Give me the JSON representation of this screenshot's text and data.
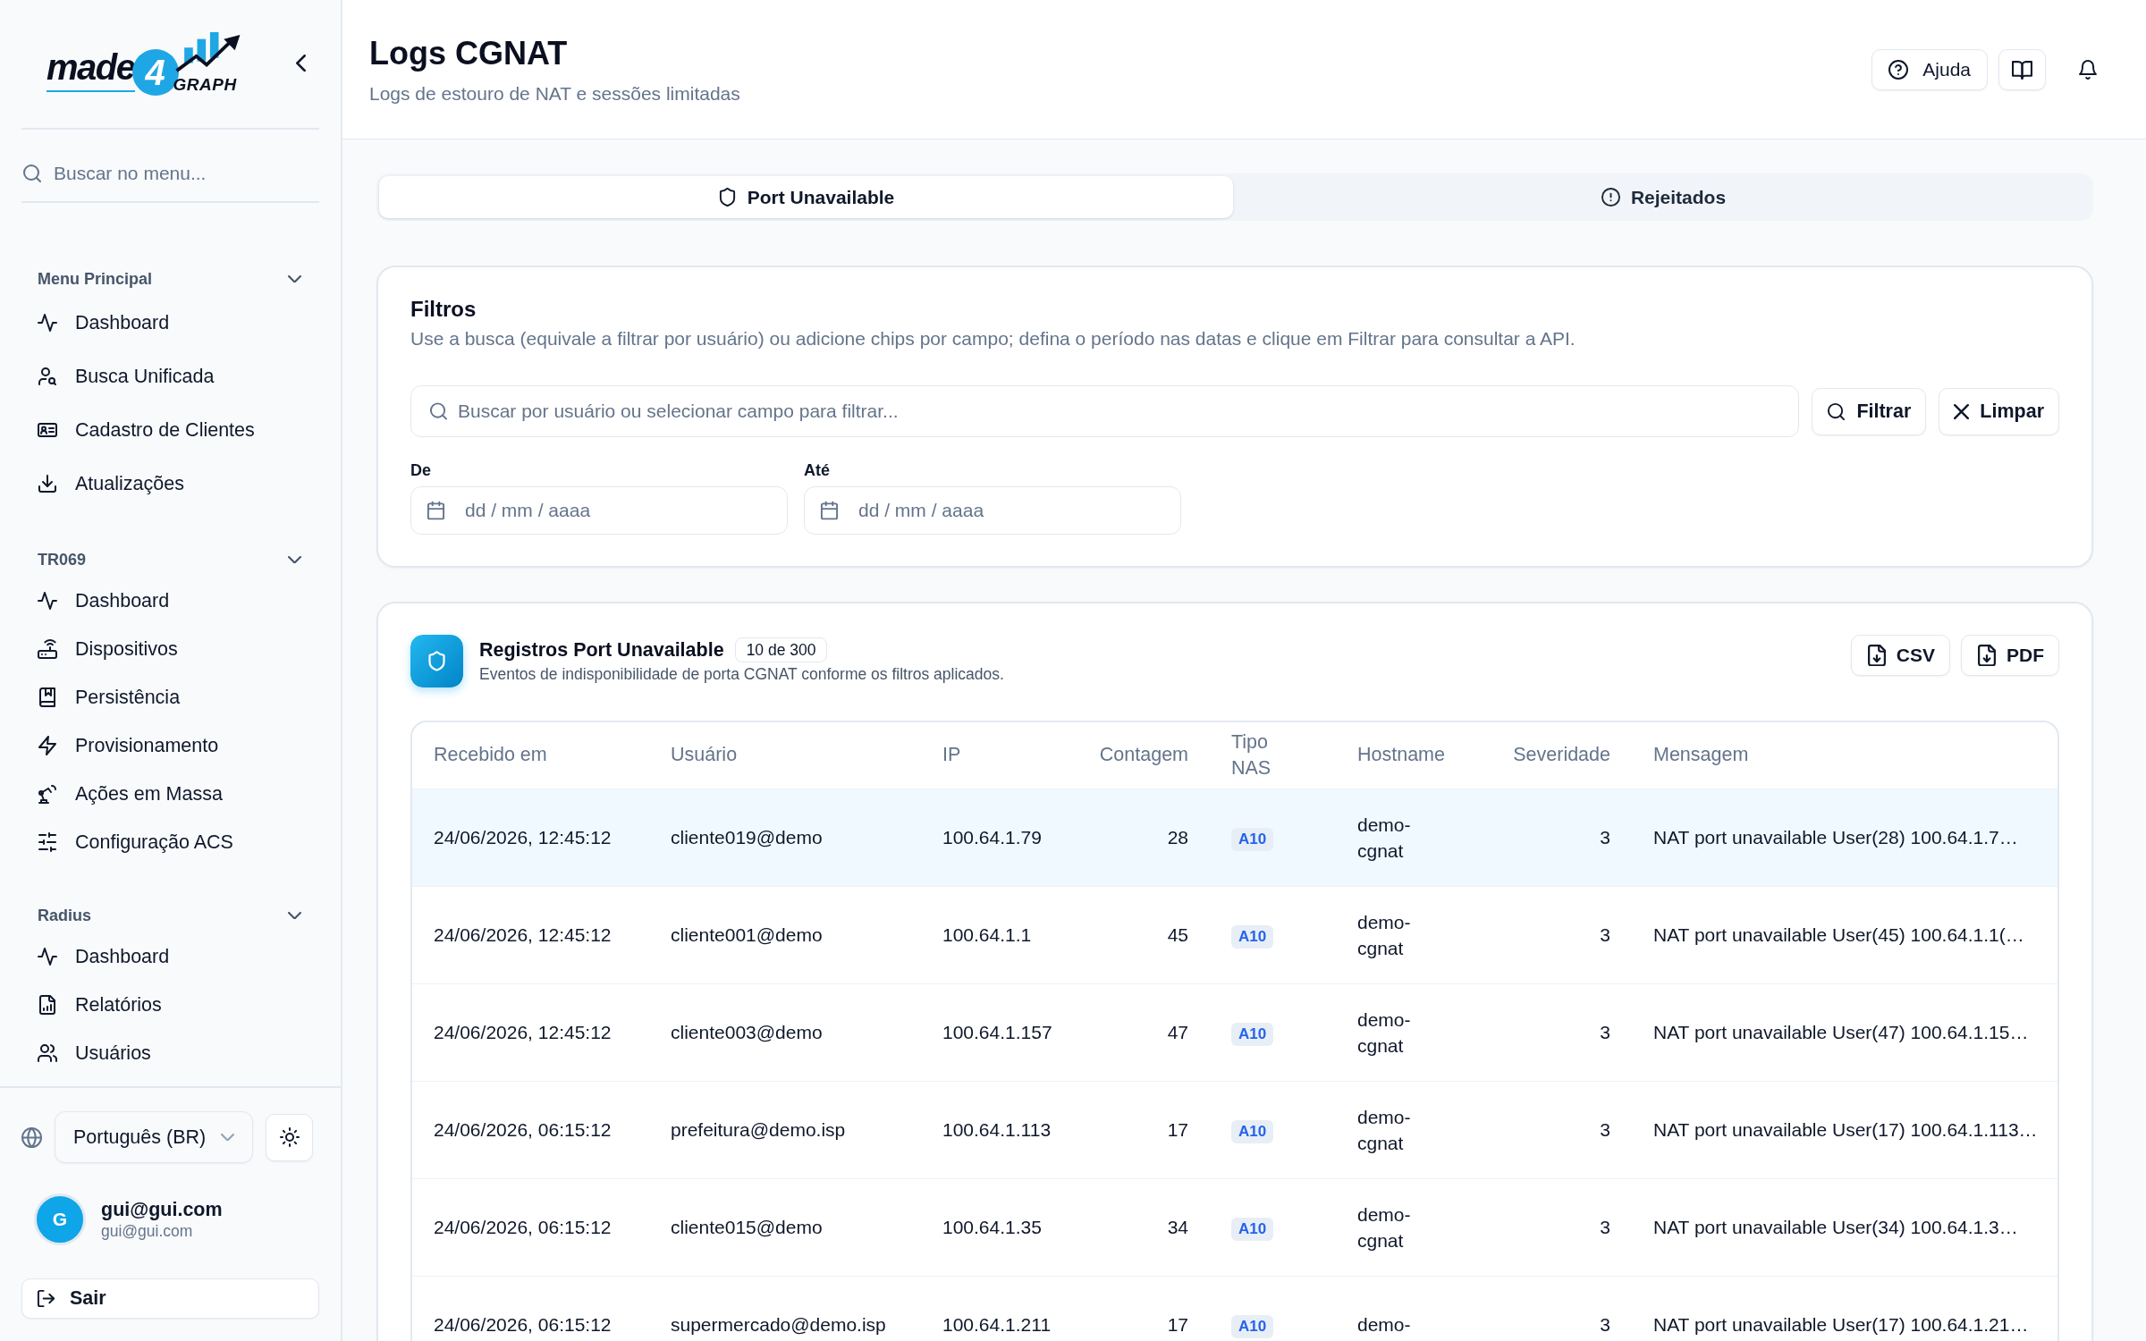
{
  "sidebar": {
    "logo": {
      "word": "made",
      "digit": "4",
      "tagline": "GRAPH"
    },
    "search": {
      "placeholder": "Buscar no menu..."
    },
    "groups": [
      {
        "title": "Menu Principal",
        "expanded": true,
        "items": [
          {
            "label": "Dashboard"
          },
          {
            "label": "Busca Unificada"
          },
          {
            "label": "Cadastro de Clientes"
          },
          {
            "label": "Atualizações"
          }
        ]
      },
      {
        "title": "TR069",
        "expanded": true,
        "items": [
          {
            "label": "Dashboard"
          },
          {
            "label": "Dispositivos"
          },
          {
            "label": "Persistência"
          },
          {
            "label": "Provisionamento"
          },
          {
            "label": "Ações em Massa"
          },
          {
            "label": "Configuração ACS"
          }
        ]
      },
      {
        "title": "Radius",
        "expanded": true,
        "items": [
          {
            "label": "Dashboard"
          },
          {
            "label": "Relatórios"
          },
          {
            "label": "Usuários"
          }
        ]
      }
    ],
    "language": "Português (BR)",
    "user": {
      "initial": "G",
      "name": "gui@gui.com",
      "email": "gui@gui.com"
    },
    "logout": "Sair"
  },
  "header": {
    "title": "Logs CGNAT",
    "subtitle": "Logs de estouro de NAT e sessões limitadas",
    "help_button": "Ajuda"
  },
  "tabs": [
    {
      "label": "Port Unavailable",
      "selected": true
    },
    {
      "label": "Rejeitados",
      "selected": false
    }
  ],
  "filters": {
    "title": "Filtros",
    "description": "Use a busca (equivale a filtrar por usuário) ou adicione chips por campo; defina o período nas datas e clique em Filtrar para consultar a API.",
    "search": {
      "placeholder": "Buscar por usuário ou selecionar campo para filtrar..."
    },
    "filter_button": "Filtrar",
    "clear_button": "Limpar",
    "date_range": [
      {
        "label": "De",
        "placeholder": "dd / mm / aaaa"
      },
      {
        "label": "Até",
        "placeholder": "dd / mm / aaaa"
      }
    ]
  },
  "records": {
    "title": "Registros Port Unavailable",
    "count": "10 de 300",
    "subtitle": "Eventos de indisponibilidade de porta CGNAT conforme os filtros aplicados.",
    "exports": [
      "CSV",
      "PDF"
    ],
    "table": {
      "columns": [
        {
          "label": "Recebido em",
          "kind": "text"
        },
        {
          "label": "Usuário",
          "kind": "text"
        },
        {
          "label": "IP",
          "kind": "text"
        },
        {
          "label": "Contagem",
          "kind": "number"
        },
        {
          "label": "Tipo NAS",
          "kind": "tag"
        },
        {
          "label": "Hostname",
          "kind": "text"
        },
        {
          "label": "Severidade",
          "kind": "number"
        },
        {
          "label": "Mensagem",
          "kind": "text"
        }
      ],
      "rows": [
        {
          "selected": true,
          "cells": [
            "24/06/2026, 12:45:12",
            "cliente019@demo",
            "100.64.1.79",
            "28",
            "A10",
            "demo-cgnat",
            "3",
            "NAT port unavailable User(28) 100.64.1.7…"
          ]
        },
        {
          "selected": false,
          "cells": [
            "24/06/2026, 12:45:12",
            "cliente001@demo",
            "100.64.1.1",
            "45",
            "A10",
            "demo-cgnat",
            "3",
            "NAT port unavailable User(45) 100.64.1.1(…"
          ]
        },
        {
          "selected": false,
          "cells": [
            "24/06/2026, 12:45:12",
            "cliente003@demo",
            "100.64.1.157",
            "47",
            "A10",
            "demo-cgnat",
            "3",
            "NAT port unavailable User(47) 100.64.1.15…"
          ]
        },
        {
          "selected": false,
          "cells": [
            "24/06/2026, 06:15:12",
            "prefeitura@demo.isp",
            "100.64.1.113",
            "17",
            "A10",
            "demo-cgnat",
            "3",
            "NAT port unavailable User(17) 100.64.1.113…"
          ]
        },
        {
          "selected": false,
          "cells": [
            "24/06/2026, 06:15:12",
            "cliente015@demo",
            "100.64.1.35",
            "34",
            "A10",
            "demo-cgnat",
            "3",
            "NAT port unavailable User(34) 100.64.1.3…"
          ]
        },
        {
          "selected": false,
          "cells": [
            "24/06/2026, 06:15:12",
            "supermercado@demo.isp",
            "100.64.1.211",
            "17",
            "A10",
            "demo-",
            "3",
            "NAT port unavailable User(17) 100.64.1.21…"
          ]
        }
      ]
    }
  }
}
